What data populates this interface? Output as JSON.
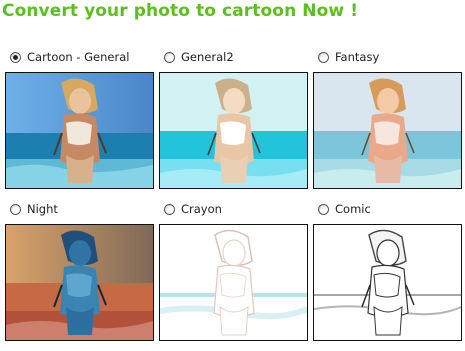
{
  "page": {
    "title": "Convert your photo to cartoon Now !"
  },
  "options": [
    {
      "label": "Cartoon - General",
      "selected": true,
      "icon": "cartoon-general-preview"
    },
    {
      "label": "General2",
      "selected": false,
      "icon": "general2-preview"
    },
    {
      "label": "Fantasy",
      "selected": false,
      "icon": "fantasy-preview"
    },
    {
      "label": "Night",
      "selected": false,
      "icon": "night-preview"
    },
    {
      "label": "Crayon",
      "selected": false,
      "icon": "crayon-preview"
    },
    {
      "label": "Comic",
      "selected": false,
      "icon": "comic-preview"
    }
  ],
  "colors": {
    "title": "#5bbf22",
    "border": "#111111"
  }
}
